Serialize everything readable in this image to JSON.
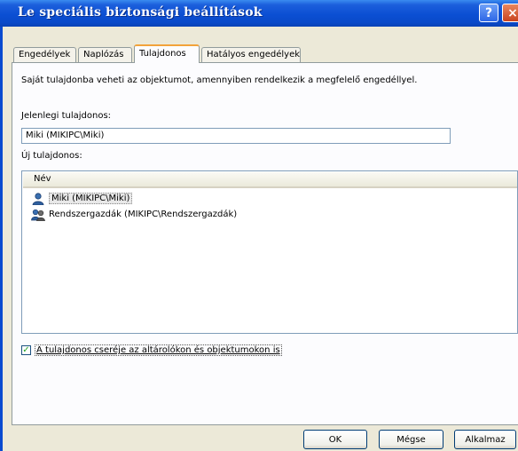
{
  "window": {
    "title": "Le speciális biztonsági beállítások"
  },
  "title_buttons": {
    "help": "?",
    "close": "×"
  },
  "tabs": [
    {
      "label": "Engedélyek"
    },
    {
      "label": "Naplózás"
    },
    {
      "label": "Tulajdonos"
    },
    {
      "label": "Hatályos engedélyek"
    }
  ],
  "owner": {
    "intro": "Saját tulajdonba veheti az objektumot, amennyiben rendelkezik a megfelelő engedéllyel.",
    "current_label": "Jelenlegi tulajdonos:",
    "current_value": "Miki (MIKIPC\\Miki)",
    "new_label": "Új tulajdonos:",
    "list_header": "Név",
    "list_items": [
      {
        "name": "Miki (MIKIPC\\Miki)",
        "icon": "user-icon",
        "selected": true
      },
      {
        "name": "Rendszergazdák (MIKIPC\\Rendszergazdák)",
        "icon": "group-icon",
        "selected": false
      }
    ],
    "replace_label": "A tulajdonos cseréje az altárolókon és objektumokon is",
    "replace_checked": true
  },
  "buttons": {
    "ok": "OK",
    "cancel": "Mégse",
    "apply": "Alkalmaz"
  }
}
